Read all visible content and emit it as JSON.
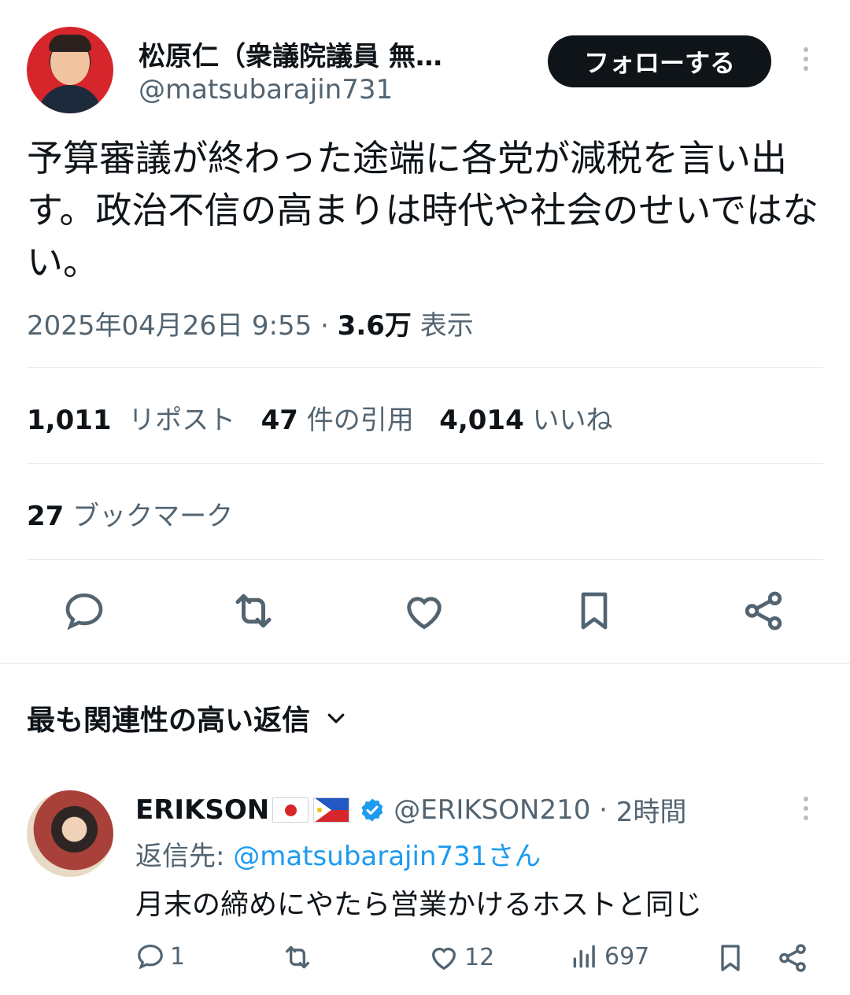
{
  "tweet": {
    "author_name": "松原仁（衆議院議員 無…",
    "author_handle": "@matsubarajin731",
    "follow_label": "フォローする",
    "text": "予算審議が終わった途端に各党が減税を言い出す。政治不信の高まりは時代や社会のせいではない。",
    "date": "2025年04月26日 9:55",
    "views_count": "3.6万",
    "views_label": "表示",
    "reposts_count": "1,011",
    "reposts_label": "リポスト",
    "quotes_count": "47",
    "quotes_label": "件の引用",
    "likes_count": "4,014",
    "likes_label": "いいね",
    "bookmarks_count": "27",
    "bookmarks_label": "ブックマーク"
  },
  "actions": {
    "icons": [
      "reply-icon",
      "retweet-icon",
      "like-icon",
      "bookmark-icon",
      "share-icon"
    ]
  },
  "replies_section": {
    "heading": "最も関連性の高い返信"
  },
  "reply": {
    "name": "ERIKSON",
    "handle": "@ERIKSON210",
    "time": "2時間",
    "reply_to_prefix": "返信先: ",
    "reply_to_handle": "@matsubarajin731さん",
    "text": "月末の締めにやたら営業かけるホストと同じ",
    "reply_count": "1",
    "like_count": "12",
    "view_count": "697",
    "verified_color": "#1d9bf0"
  },
  "colors": {
    "accent": "#1d9bf0",
    "text": "#0f1419",
    "muted": "#536471",
    "border": "#e5e8eb"
  }
}
